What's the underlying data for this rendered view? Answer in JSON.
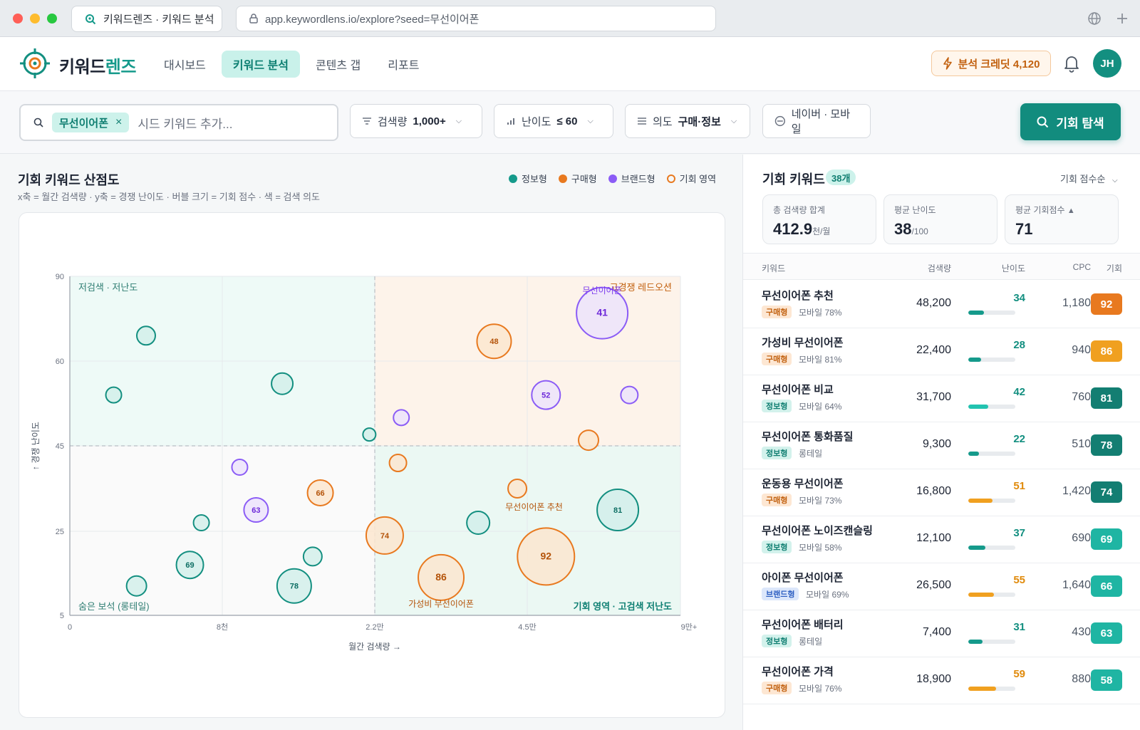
{
  "browser": {
    "tab_title": "키워드렌즈 · 키워드 분석",
    "url": "app.keywordlens.io/explore?seed=무선이어폰"
  },
  "header": {
    "brand_main": "키워드",
    "brand_accent": "렌즈",
    "nav": [
      {
        "label": "대시보드",
        "active": false
      },
      {
        "label": "키워드 분석",
        "active": true
      },
      {
        "label": "콘텐츠 갭",
        "active": false
      },
      {
        "label": "리포트",
        "active": false
      }
    ],
    "credit_label": "분석 크레딧 4,120",
    "avatar": "JH"
  },
  "filters": {
    "seed_chip": "무선이어폰",
    "chip_remove": "×",
    "search_placeholder": "시드 키워드 추가...",
    "volume": {
      "label": "검색량",
      "value": "1,000+"
    },
    "difficulty": {
      "label": "난이도",
      "value": "≤ 60"
    },
    "intent": {
      "label": "의도",
      "value": "구매·정보"
    },
    "platform": {
      "label": "네이버 · 모바일"
    },
    "explore_button": "기회 탐색"
  },
  "chart_panel": {
    "title": "기회 키워드 산점도",
    "subtitle": "x축 = 월간 검색량 · y축 = 경쟁 난이도 · 버블 크기 = 기회 점수 · 색 = 검색 의도",
    "legend": [
      {
        "label": "정보형",
        "color": "#159a8b",
        "style": "fill"
      },
      {
        "label": "구매형",
        "color": "#e8791f",
        "style": "fill"
      },
      {
        "label": "브랜드형",
        "color": "#8b5cf6",
        "style": "fill"
      },
      {
        "label": "기회 영역",
        "color": "#e8791f",
        "style": "ring"
      }
    ]
  },
  "chart_data": {
    "type": "scatter",
    "xlabel": "월간 검색량 →",
    "ylabel": "↑ 경쟁 난이도",
    "x_ticks": [
      {
        "value": 0,
        "label": "0"
      },
      {
        "value": 8000,
        "label": "8천"
      },
      {
        "value": 22000,
        "label": "2.2만"
      },
      {
        "value": 45000,
        "label": "4.5만"
      },
      {
        "value": 90000,
        "label": "9만+"
      }
    ],
    "y_ticks": [
      5,
      25,
      45,
      60,
      90
    ],
    "quadrant_labels": {
      "top_left": "저검색 · 저난도",
      "top_right": "고경쟁 레드오션",
      "bottom_left": "숨은 보석 (롱테일)",
      "bottom_right": "기회 영역 · 고검색 저난도"
    },
    "thresholds": {
      "volume": 22000,
      "difficulty": 45
    },
    "point_labels": [
      {
        "text": "무선이어폰",
        "x": 67000,
        "y": 84,
        "color": "#7c3aed"
      },
      {
        "text": "무선이어폰 추천",
        "x": 47000,
        "y": 30,
        "color": "#b45309"
      },
      {
        "text": "가성비 무선이어폰",
        "x": 32000,
        "y": 7,
        "color": "#b45309"
      }
    ],
    "points": [
      {
        "x": 4000,
        "y": 69,
        "score": null,
        "intent": "정보형",
        "size": 13
      },
      {
        "x": 2300,
        "y": 54,
        "score": null,
        "intent": "정보형",
        "size": 11
      },
      {
        "x": 13500,
        "y": 56,
        "score": null,
        "intent": "정보형",
        "size": 15
      },
      {
        "x": 21500,
        "y": 47,
        "score": null,
        "intent": "정보형",
        "size": 9
      },
      {
        "x": 40000,
        "y": 67,
        "score": 48,
        "intent": "구매형",
        "size": 24
      },
      {
        "x": 67000,
        "y": 77,
        "score": 41,
        "intent": "브랜드형",
        "size": 36
      },
      {
        "x": 50500,
        "y": 54,
        "score": 52,
        "intent": "브랜드형",
        "size": 20
      },
      {
        "x": 26000,
        "y": 50,
        "score": null,
        "intent": "브랜드형",
        "size": 11
      },
      {
        "x": 75000,
        "y": 54,
        "score": null,
        "intent": "브랜드형",
        "size": 12
      },
      {
        "x": 63000,
        "y": 46,
        "score": null,
        "intent": "구매형",
        "size": 14
      },
      {
        "x": 25500,
        "y": 41,
        "score": null,
        "intent": "구매형",
        "size": 12
      },
      {
        "x": 43500,
        "y": 35,
        "score": null,
        "intent": "구매형",
        "size": 13
      },
      {
        "x": 9600,
        "y": 40,
        "score": null,
        "intent": "브랜드형",
        "size": 11
      },
      {
        "x": 17000,
        "y": 34,
        "score": 66,
        "intent": "구매형",
        "size": 18
      },
      {
        "x": 11100,
        "y": 30,
        "score": 63,
        "intent": "브랜드형",
        "size": 17
      },
      {
        "x": 6900,
        "y": 27,
        "score": null,
        "intent": "정보형",
        "size": 11
      },
      {
        "x": 23500,
        "y": 24,
        "score": 74,
        "intent": "구매형",
        "size": 26
      },
      {
        "x": 37600,
        "y": 27,
        "score": null,
        "intent": "정보형",
        "size": 16
      },
      {
        "x": 71600,
        "y": 30,
        "score": 81,
        "intent": "정보형",
        "size": 29
      },
      {
        "x": 14600,
        "y": 12,
        "score": 78,
        "intent": "정보형",
        "size": 24
      },
      {
        "x": 6300,
        "y": 17,
        "score": 69,
        "intent": "정보형",
        "size": 19
      },
      {
        "x": 3500,
        "y": 12,
        "score": null,
        "intent": "정보형",
        "size": 14
      },
      {
        "x": 16300,
        "y": 19,
        "score": null,
        "intent": "정보형",
        "size": 13
      },
      {
        "x": 32000,
        "y": 14,
        "score": 86,
        "intent": "구매형",
        "size": 32
      },
      {
        "x": 50500,
        "y": 19,
        "score": 92,
        "intent": "구매형",
        "size": 40
      }
    ]
  },
  "right_panel": {
    "title": "기회 키워드",
    "count": "38개",
    "sort": "기회 점수순",
    "stats": [
      {
        "label": "총 검색량 합계",
        "value": "412.9",
        "unit": "천/월",
        "arrow": ""
      },
      {
        "label": "평균 난이도",
        "value": "38",
        "unit": "/100",
        "arrow": ""
      },
      {
        "label": "평균 기회점수",
        "value": "71",
        "unit": "",
        "arrow": "▲"
      }
    ],
    "columns": [
      "키워드",
      "검색량",
      "난이도",
      "CPC",
      "기회"
    ],
    "rows": [
      {
        "keyword": "무선이어폰 추천",
        "intent": "구매형",
        "sub": "모바일 78%",
        "volume": "48,200",
        "difficulty": 34,
        "cpc": "1,180",
        "score": 92
      },
      {
        "keyword": "가성비 무선이어폰",
        "intent": "구매형",
        "sub": "모바일 81%",
        "volume": "22,400",
        "difficulty": 28,
        "cpc": "940",
        "score": 86
      },
      {
        "keyword": "무선이어폰 비교",
        "intent": "정보형",
        "sub": "모바일 64%",
        "volume": "31,700",
        "difficulty": 42,
        "cpc": "760",
        "score": 81
      },
      {
        "keyword": "무선이어폰 통화품질",
        "intent": "정보형",
        "sub": "롱테일",
        "volume": "9,300",
        "difficulty": 22,
        "cpc": "510",
        "score": 78
      },
      {
        "keyword": "운동용 무선이어폰",
        "intent": "구매형",
        "sub": "모바일 73%",
        "volume": "16,800",
        "difficulty": 51,
        "cpc": "1,420",
        "score": 74
      },
      {
        "keyword": "무선이어폰 노이즈캔슬링",
        "intent": "정보형",
        "sub": "모바일 58%",
        "volume": "12,100",
        "difficulty": 37,
        "cpc": "690",
        "score": 69
      },
      {
        "keyword": "아이폰 무선이어폰",
        "intent": "브랜드형",
        "sub": "모바일 69%",
        "volume": "26,500",
        "difficulty": 55,
        "cpc": "1,640",
        "score": 66
      },
      {
        "keyword": "무선이어폰 배터리",
        "intent": "정보형",
        "sub": "롱테일",
        "volume": "7,400",
        "difficulty": 31,
        "cpc": "430",
        "score": 63
      },
      {
        "keyword": "무선이어폰 가격",
        "intent": "구매형",
        "sub": "모바일 76%",
        "volume": "18,900",
        "difficulty": 59,
        "cpc": "880",
        "score": 58
      }
    ]
  },
  "colors": {
    "accent": "#128c7e",
    "info": "#159a8b",
    "buy": "#e8791f",
    "brand": "#8b5cf6"
  }
}
